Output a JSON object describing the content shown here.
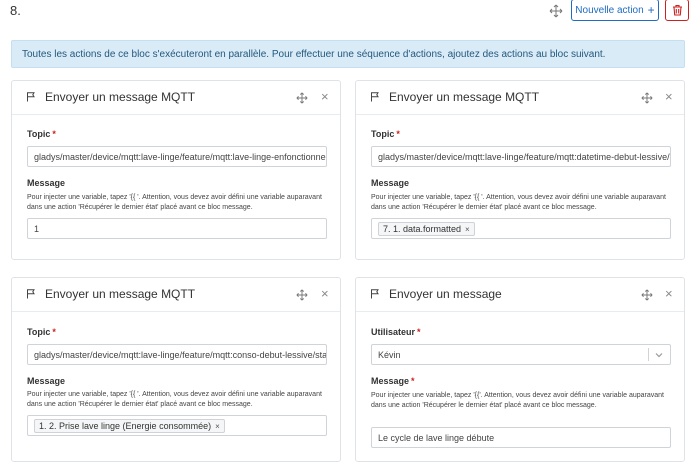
{
  "step": {
    "number": "8.",
    "new_action_label": "Nouvelle action",
    "plus": "+"
  },
  "info": "Toutes les actions de ce bloc s'exécuteront en parallèle. Pour effectuer une séquence d'actions, ajoutez des actions au bloc suivant.",
  "cards": [
    {
      "title": "Envoyer un message MQTT",
      "topic_label": "Topic",
      "topic_value": "gladys/master/device/mqtt:lave-linge/feature/mqtt:lave-linge-enfonctionnement/state",
      "message_label": "Message",
      "help": "Pour injecter une variable, tapez '{{ '. Attention, vous devez avoir défini une variable auparavant dans une action 'Récupérer le dernier état' placé avant ce bloc message.",
      "message_value": "1"
    },
    {
      "title": "Envoyer un message MQTT",
      "topic_label": "Topic",
      "topic_value": "gladys/master/device/mqtt:lave-linge/feature/mqtt:datetime-debut-lessive/state",
      "message_label": "Message",
      "help": "Pour injecter une variable, tapez '{{ '. Attention, vous devez avoir défini une variable auparavant dans une action 'Récupérer le dernier état' placé avant ce bloc message.",
      "message_tag": "7. 1. data.formatted",
      "tag_remove": "×"
    },
    {
      "title": "Envoyer un message MQTT",
      "topic_label": "Topic",
      "topic_value": "gladys/master/device/mqtt:lave-linge/feature/mqtt:conso-debut-lessive/state",
      "message_label": "Message",
      "help": "Pour injecter une variable, tapez '{{ '. Attention, vous devez avoir défini une variable auparavant dans une action 'Récupérer le dernier état' placé avant ce bloc message.",
      "message_tag": "1. 2. Prise lave linge (Energie consommée)",
      "tag_remove": "×"
    },
    {
      "title": "Envoyer un message",
      "user_label": "Utilisateur",
      "user_value": "Kévin",
      "message_label": "Message",
      "help": "Pour injecter une variable, tapez '{{'. Attention, vous devez avoir défini une variable auparavant dans une action 'Récupérer le dernier état' placé avant ce bloc message.",
      "message_value": "Le cycle de lave linge débute"
    }
  ],
  "icons": {
    "move": "move-icon",
    "close": "close-icon",
    "flag": "flag-icon",
    "trash": "trash-icon",
    "chevron": "chevron-down-icon"
  },
  "colors": {
    "primary": "#206bc4",
    "danger": "#cd201f",
    "info_bg": "#d9ebf7"
  },
  "required_mark": "*",
  "close_glyph": "×"
}
